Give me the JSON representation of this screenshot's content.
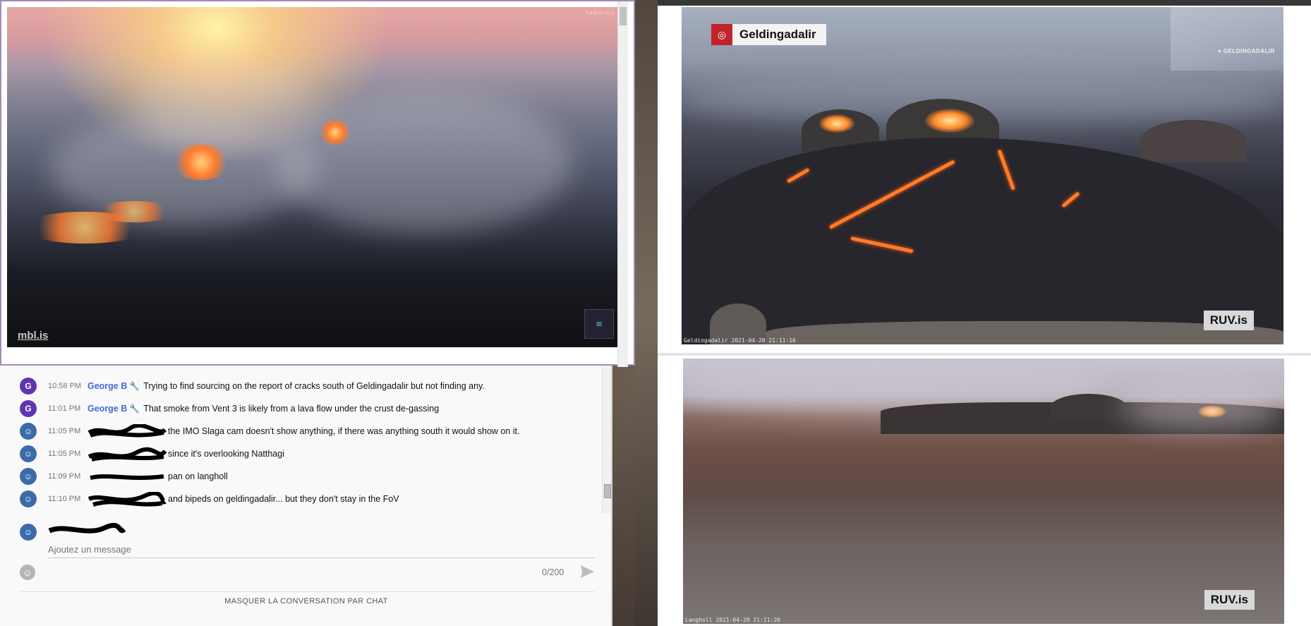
{
  "left_video": {
    "watermark": "mbl.is",
    "brand_mark": "SAMSUNG"
  },
  "chat": {
    "messages": [
      {
        "avatar": "G",
        "time": "10:58 PM",
        "author": "George B",
        "text": "Trying to find sourcing on the report of cracks south of Geldingadalir but not finding any."
      },
      {
        "avatar": "G",
        "time": "11:01 PM",
        "author": "George B",
        "text": "That smoke from Vent 3 is likely from a lava flow under the crust de-gassing"
      },
      {
        "avatar": "photo",
        "time": "11:05 PM",
        "author": "",
        "text": "the IMO Slaga cam doesn't show anything, if there was anything south it would show on it."
      },
      {
        "avatar": "photo",
        "time": "11:05 PM",
        "author": "",
        "text": "since it's overlooking Natthagi"
      },
      {
        "avatar": "photo",
        "time": "11:09 PM",
        "author": "",
        "text": "pan on langholl"
      },
      {
        "avatar": "photo",
        "time": "11:10 PM",
        "author": "",
        "text": "and bipeds on geldingadalir... but they don't stay in the FoV"
      }
    ],
    "composer": {
      "placeholder": "Ajoutez un message",
      "counter": "0/200"
    },
    "hide_chat_label": "MASQUER LA CONVERSATION PAR CHAT"
  },
  "ruv_top": {
    "location_badge": "Geldingadalir",
    "map_label": "GELDINGADALIR",
    "brand": "RUV.is",
    "cam_label": "Geldingadalir 2021-04-20 21:11:16"
  },
  "ruv_bottom": {
    "brand": "RUV.is",
    "cam_label": "Langholl 2021-04-20 21:11:20"
  },
  "icons": {
    "emoji": "smiley-icon",
    "send": "send-arrow-icon",
    "wrench": "wrench-icon",
    "location_pin": "pin-icon"
  }
}
